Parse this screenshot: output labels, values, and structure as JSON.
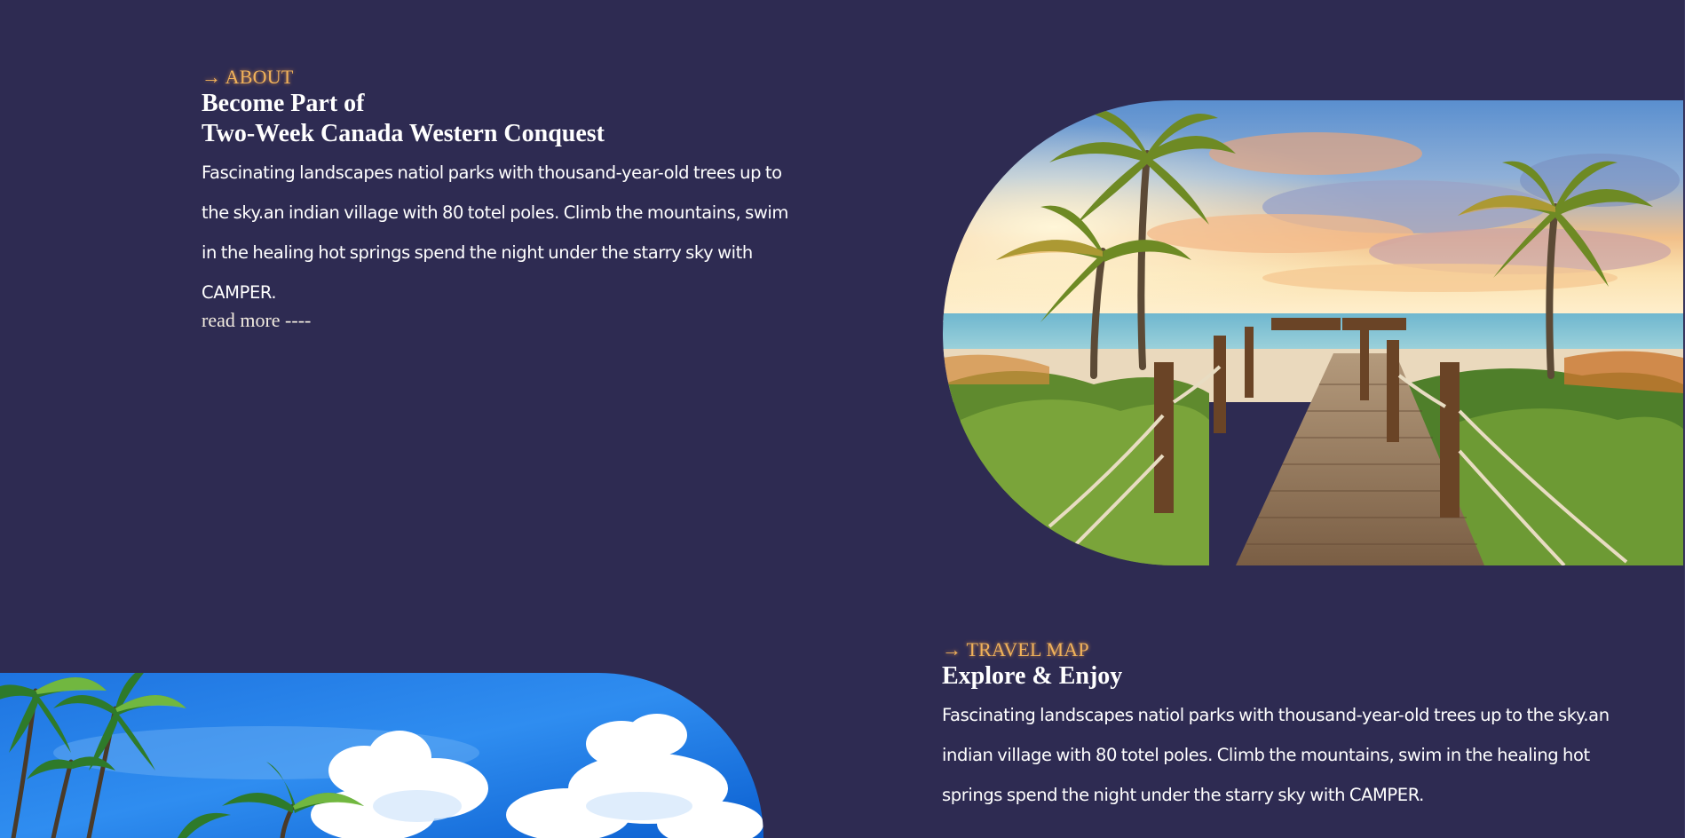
{
  "about": {
    "eyebrow": "→ ABOUT",
    "heading_line1": "Become Part of",
    "heading_line2": "Two-Week Canada Western Conquest",
    "body": "Fascinating landscapes natiol parks with thousand-year-old trees up to the sky.an indian village with 80 totel poles. Climb the mountains, swim in the healing hot springs spend the night under the starry sky with CAMPER.",
    "read_more": "read more ----"
  },
  "travel_map": {
    "eyebrow": "→ TRAVEL MAP",
    "heading": "Explore & Enjoy",
    "body": "Fascinating landscapes natiol parks with thousand-year-old trees up to the sky.an indian village with 80 totel poles. Climb the mountains, swim in the healing hot springs spend the night under the starry sky with CAMPER."
  },
  "colors": {
    "background": "#2e2b52",
    "accent": "#f1b25a",
    "text": "#ffffff"
  }
}
